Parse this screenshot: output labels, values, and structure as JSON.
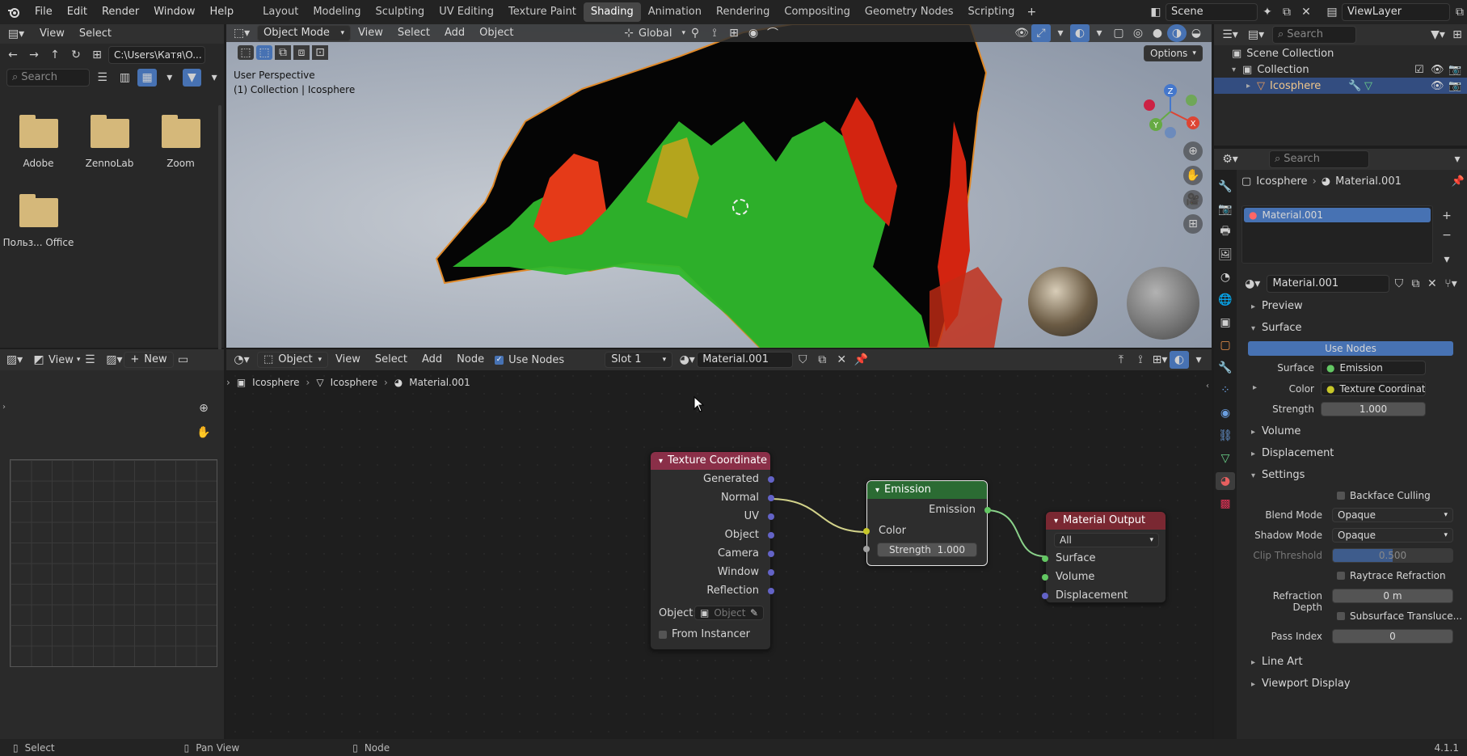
{
  "topbar": {
    "menus": [
      "File",
      "Edit",
      "Render",
      "Window",
      "Help"
    ],
    "workspaces": [
      "Layout",
      "Modeling",
      "Sculpting",
      "UV Editing",
      "Texture Paint",
      "Shading",
      "Animation",
      "Rendering",
      "Compositing",
      "Geometry Nodes",
      "Scripting"
    ],
    "active_workspace": "Shading",
    "scene": "Scene",
    "view_layer": "ViewLayer"
  },
  "file_browser": {
    "menus": [
      "View",
      "Select"
    ],
    "path": "C:\\Users\\Катя\\O...",
    "search_placeholder": "Search",
    "folders": [
      "Adobe",
      "ZennoLab",
      "Zoom",
      "Польз... Office"
    ]
  },
  "viewport": {
    "mode": "Object Mode",
    "menus": [
      "View",
      "Select",
      "Add",
      "Object"
    ],
    "transform": "Global",
    "options_label": "Options",
    "overlay_line1": "User Perspective",
    "overlay_line2": "(1) Collection | Icosphere",
    "gizmo": {
      "x": "X",
      "y": "Y",
      "z": "Z"
    }
  },
  "image_editor": {
    "view_label": "View",
    "new_label": "New"
  },
  "node_editor": {
    "type": "Object",
    "menus": [
      "View",
      "Select",
      "Add",
      "Node"
    ],
    "use_nodes_label": "Use Nodes",
    "slot": "Slot 1",
    "material": "Material.001",
    "breadcrumb": [
      "Icosphere",
      "Icosphere",
      "Material.001"
    ],
    "nodes": {
      "texcoord": {
        "title": "Texture Coordinate",
        "outputs": [
          "Generated",
          "Normal",
          "UV",
          "Object",
          "Camera",
          "Window",
          "Reflection"
        ],
        "object_label": "Object:",
        "object_placeholder": "Object",
        "from_instancer": "From Instancer"
      },
      "emission": {
        "title": "Emission",
        "output": "Emission",
        "color_label": "Color",
        "strength_label": "Strength",
        "strength_value": "1.000"
      },
      "output": {
        "title": "Material Output",
        "target": "All",
        "inputs": [
          "Surface",
          "Volume",
          "Displacement"
        ]
      }
    }
  },
  "outliner": {
    "search_placeholder": "Search",
    "scene_collection": "Scene Collection",
    "collection": "Collection",
    "object": "Icosphere"
  },
  "properties": {
    "search_placeholder": "Search",
    "breadcrumb_object": "Icosphere",
    "breadcrumb_material": "Material.001",
    "slot_material": "Material.001",
    "material_name": "Material.001",
    "preview": "Preview",
    "surface_section": "Surface",
    "use_nodes": "Use Nodes",
    "surface_label": "Surface",
    "surface_value": "Emission",
    "color_label": "Color",
    "color_value": "Texture Coordinate ...",
    "strength_label": "Strength",
    "strength_value": "1.000",
    "volume": "Volume",
    "displacement": "Displacement",
    "settings": "Settings",
    "backface": "Backface Culling",
    "blend_label": "Blend Mode",
    "blend_value": "Opaque",
    "shadow_label": "Shadow Mode",
    "shadow_value": "Opaque",
    "clip_label": "Clip Threshold",
    "clip_value": "0.500",
    "raytrace": "Raytrace Refraction",
    "refr_label": "Refraction Depth",
    "refr_value": "0 m",
    "sss": "Subsurface Transluce...",
    "pass_label": "Pass Index",
    "pass_value": "0",
    "line_art": "Line Art",
    "viewport_display": "Viewport Display"
  },
  "statusbar": {
    "select": "Select",
    "pan": "Pan View",
    "node": "Node",
    "version": "4.1.1"
  },
  "colors": {
    "accent": "#4772b3",
    "texcoord_header": "#8a2f48",
    "emission_header": "#2b6b33",
    "output_header": "#7a2832",
    "socket_vector": "#6363c7",
    "socket_color": "#c7c729",
    "socket_shader": "#63c763",
    "socket_float": "#a1a1a1"
  }
}
